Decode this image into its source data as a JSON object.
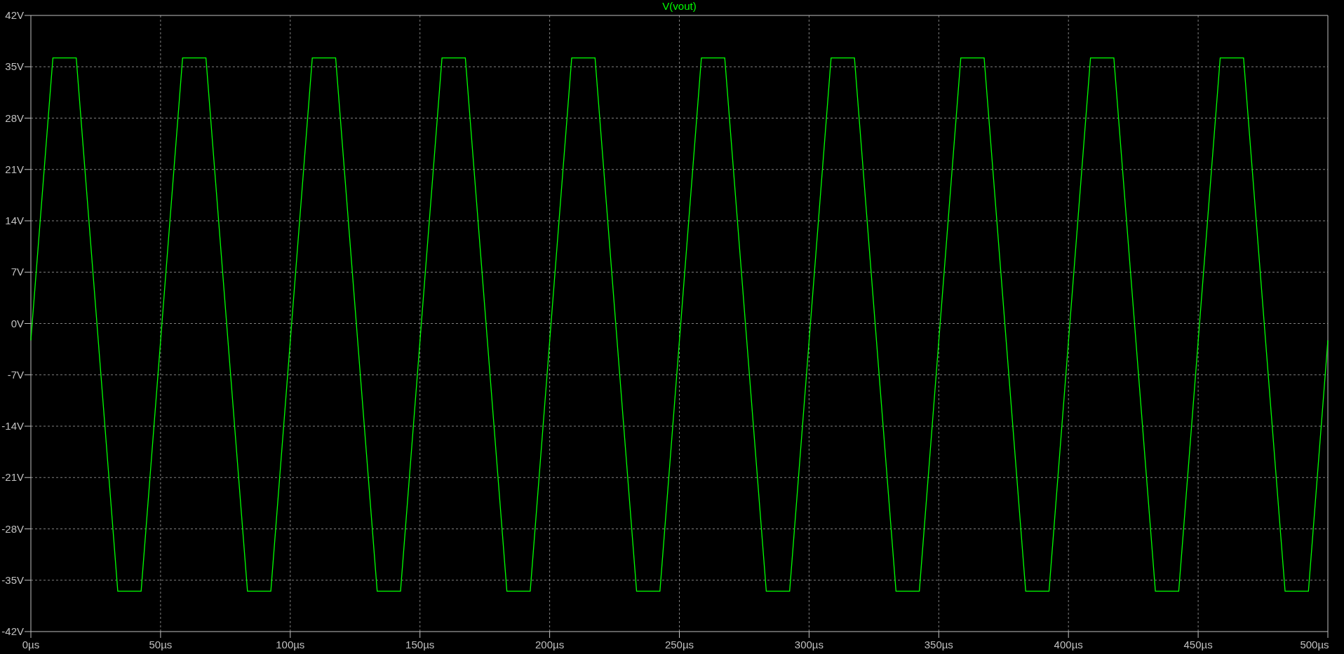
{
  "plot": {
    "chart_data": {
      "type": "line",
      "grid": true,
      "x": [
        0,
        8.5,
        17.5,
        33.5,
        42.5,
        58.5,
        67.5,
        83.5,
        92.5,
        108.5,
        117.5,
        133.5,
        142.5,
        158.5,
        167.5,
        183.5,
        192.5,
        208.5,
        217.5,
        233.5,
        242.5,
        258.5,
        267.5,
        283.5,
        292.5,
        308.5,
        317.5,
        333.5,
        342.5,
        358.5,
        367.5,
        383.5,
        392.5,
        408.5,
        417.5,
        433.5,
        442.5,
        458.5,
        467.5,
        483.5,
        492.5,
        500
      ],
      "series": [
        {
          "name": "V(vout)",
          "color": "#00ff00",
          "values": [
            -2.3,
            36.2,
            36.2,
            -36.5,
            -36.5,
            36.2,
            36.2,
            -36.5,
            -36.5,
            36.2,
            36.2,
            -36.5,
            -36.5,
            36.2,
            36.2,
            -36.5,
            -36.5,
            36.2,
            36.2,
            -36.5,
            -36.5,
            36.2,
            36.2,
            -36.5,
            -36.5,
            36.2,
            36.2,
            -36.5,
            -36.5,
            36.2,
            36.2,
            -36.5,
            -36.5,
            36.2,
            36.2,
            -36.5,
            -36.5,
            36.2,
            36.2,
            -36.5,
            -36.5,
            -2.3
          ]
        }
      ],
      "xlim": [
        0,
        500
      ],
      "ylim": [
        -42,
        42
      ],
      "xticks": [
        {
          "value": 0,
          "label": "0µs"
        },
        {
          "value": 50,
          "label": "50µs"
        },
        {
          "value": 100,
          "label": "100µs"
        },
        {
          "value": 150,
          "label": "150µs"
        },
        {
          "value": 200,
          "label": "200µs"
        },
        {
          "value": 250,
          "label": "250µs"
        },
        {
          "value": 300,
          "label": "300µs"
        },
        {
          "value": 350,
          "label": "350µs"
        },
        {
          "value": 400,
          "label": "400µs"
        },
        {
          "value": 450,
          "label": "450µs"
        },
        {
          "value": 500,
          "label": "500µs"
        }
      ],
      "yticks": [
        {
          "value": 42,
          "label": "42V"
        },
        {
          "value": 35,
          "label": "35V"
        },
        {
          "value": 28,
          "label": "28V"
        },
        {
          "value": 21,
          "label": "21V"
        },
        {
          "value": 14,
          "label": "14V"
        },
        {
          "value": 7,
          "label": "7V"
        },
        {
          "value": 0,
          "label": "0V"
        },
        {
          "value": -7,
          "label": "-7V"
        },
        {
          "value": -14,
          "label": "-14V"
        },
        {
          "value": -21,
          "label": "-21V"
        },
        {
          "value": -28,
          "label": "-28V"
        },
        {
          "value": -35,
          "label": "-35V"
        },
        {
          "value": -42,
          "label": "-42V"
        }
      ]
    }
  }
}
